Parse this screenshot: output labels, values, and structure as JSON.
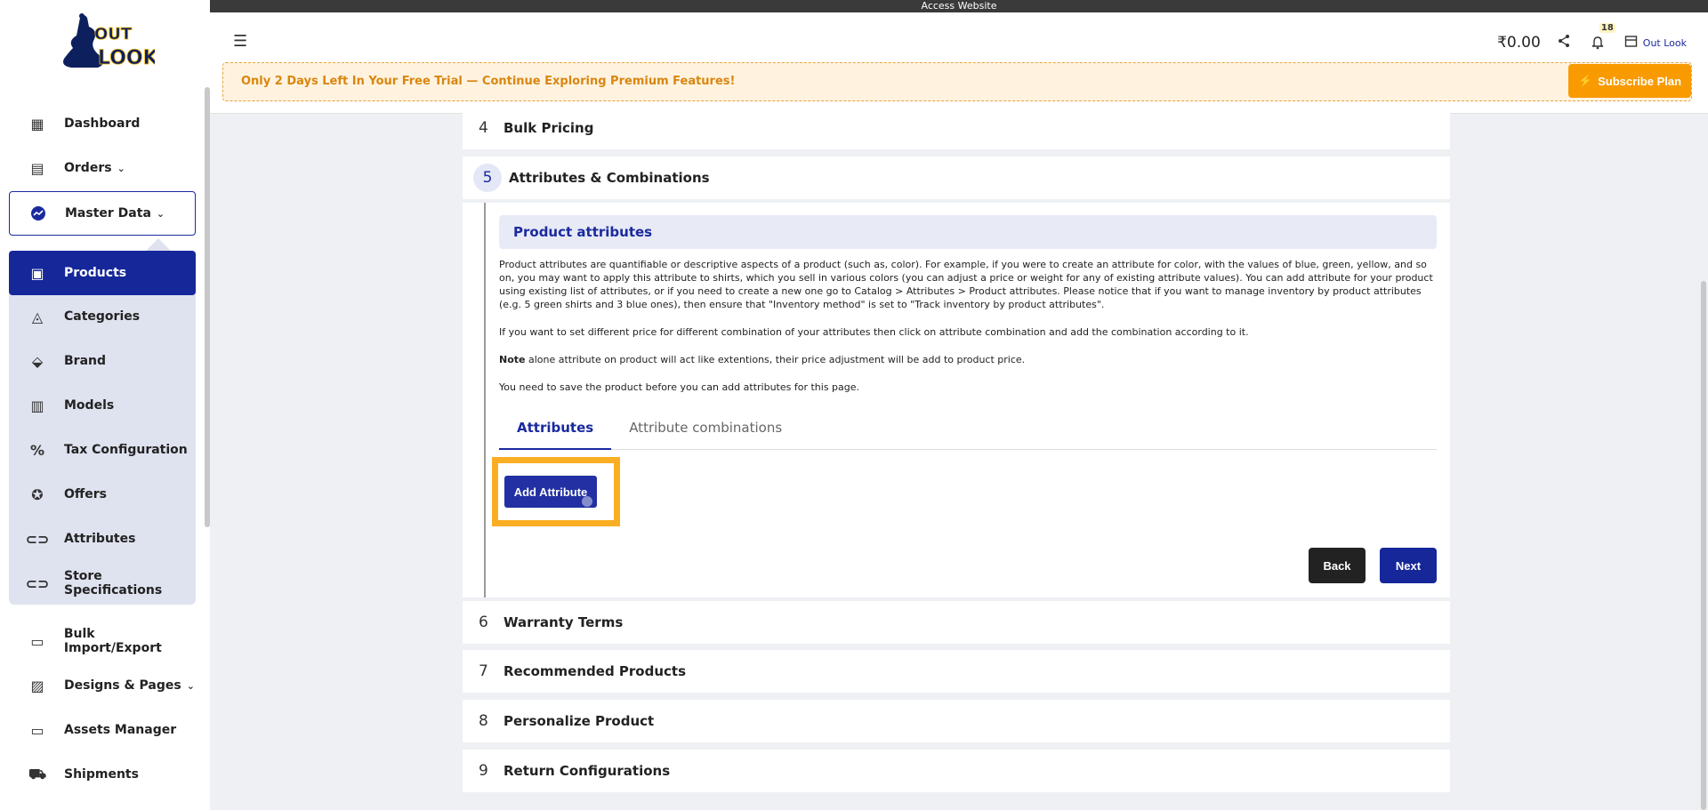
{
  "topbar": {
    "access_label": "Access Website"
  },
  "brand": {
    "logo_name": "logo-icon",
    "logo_text_top": "OUT",
    "logo_text_bottom": "LOOK"
  },
  "sidebar": {
    "items": [
      {
        "label": "Dashboard",
        "icon": "dashboard-icon"
      },
      {
        "label": "Orders",
        "icon": "orders-icon"
      },
      {
        "label": "Master Data",
        "icon": "master-data-icon"
      },
      {
        "label": "Products",
        "icon": "products-icon"
      },
      {
        "label": "Categories",
        "icon": "categories-icon"
      },
      {
        "label": "Brand",
        "icon": "tag-icon"
      },
      {
        "label": "Models",
        "icon": "models-icon"
      },
      {
        "label": "Tax Configuration",
        "icon": "percent-icon"
      },
      {
        "label": "Offers",
        "icon": "offers-icon"
      },
      {
        "label": "Attributes",
        "icon": "attributes-icon"
      },
      {
        "label": "Store Specifications",
        "icon": "specifications-icon"
      },
      {
        "label": "Bulk Import/Export",
        "icon": "folder-icon"
      },
      {
        "label": "Designs & Pages",
        "icon": "designs-icon"
      },
      {
        "label": "Assets Manager",
        "icon": "folder-icon"
      },
      {
        "label": "Shipments",
        "icon": "truck-icon"
      }
    ]
  },
  "header": {
    "amount": "₹0.00",
    "notification_count": "18",
    "store_name": "Out Look",
    "trial_text": "Only 2 Days Left In Your Free Trial — Continue Exploring Premium Features!",
    "subscribe_label": "Subscribe Plan"
  },
  "steps": [
    {
      "num": "4",
      "title": "Bulk Pricing"
    },
    {
      "num": "5",
      "title": "Attributes & Combinations"
    },
    {
      "num": "6",
      "title": "Warranty Terms"
    },
    {
      "num": "7",
      "title": "Recommended Products"
    },
    {
      "num": "8",
      "title": "Personalize Product"
    },
    {
      "num": "9",
      "title": "Return Configurations"
    }
  ],
  "attributes_panel": {
    "header": "Product attributes",
    "para1": "Product attributes are quantifiable or descriptive aspects of a product (such as, color). For example, if you were to create an attribute for color, with the values of blue, green, yellow, and so on, you may want to apply this attribute to shirts, which you sell in various colors (you can adjust a price or weight for any of existing attribute values). You can add attribute for your product using existing list of attributes, or if you need to create a new one go to Catalog > Attributes > Product attributes. Please notice that if you want to manage inventory by product attributes (e.g. 5 green shirts and 3 blue ones), then ensure that \"Inventory method\" is set to \"Track inventory by product attributes\".",
    "para2": "If you want to set different price for different combination of your attributes then click on attribute combination and add the combination according to it.",
    "note_label": "Note",
    "note_text": " alone attribute on product will act like extentions, their price adjustment will be add to product price.",
    "para4": "You need to save the product before you can add attributes for this page.",
    "tabs": [
      "Attributes",
      "Attribute combinations"
    ],
    "add_button": "Add Attribute",
    "back_button": "Back",
    "next_button": "Next"
  }
}
